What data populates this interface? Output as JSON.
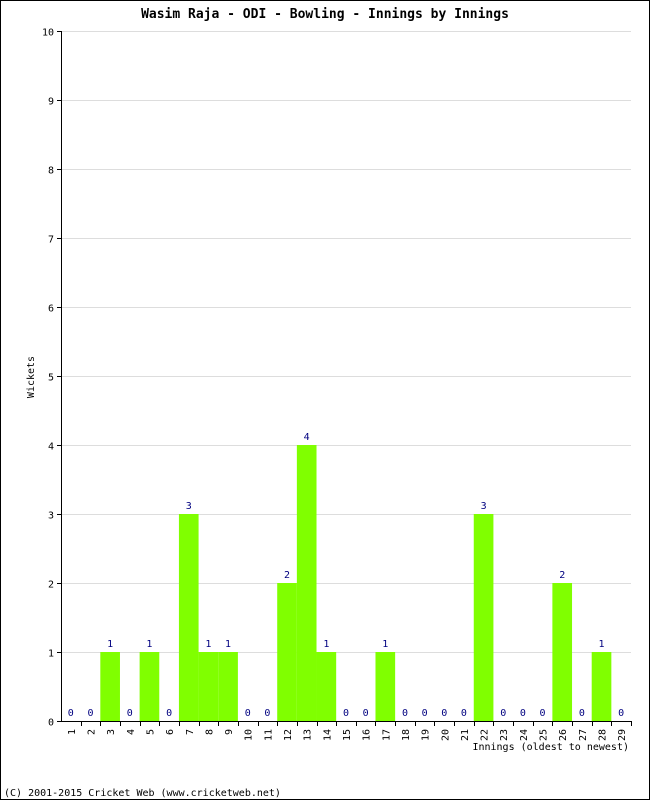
{
  "chart_data": {
    "type": "bar",
    "title": "Wasim Raja - ODI - Bowling - Innings by Innings",
    "xlabel": "Innings (oldest to newest)",
    "ylabel": "Wickets",
    "ylim": [
      0,
      10
    ],
    "yticks": [
      "0",
      "1",
      "2",
      "3",
      "4",
      "5",
      "6",
      "7",
      "8",
      "9",
      "10"
    ],
    "grid": true,
    "categories": [
      "1",
      "2",
      "3",
      "4",
      "5",
      "6",
      "7",
      "8",
      "9",
      "10",
      "11",
      "12",
      "13",
      "14",
      "15",
      "16",
      "17",
      "18",
      "19",
      "20",
      "21",
      "22",
      "23",
      "24",
      "25",
      "26",
      "27",
      "28",
      "29"
    ],
    "values": [
      0,
      0,
      1,
      0,
      1,
      0,
      3,
      1,
      1,
      0,
      0,
      2,
      4,
      1,
      0,
      0,
      1,
      0,
      0,
      0,
      0,
      3,
      0,
      0,
      0,
      2,
      0,
      1,
      0
    ],
    "bar_color": "#80ff00",
    "label_color": "#000080",
    "grid_color": "#dddddd"
  },
  "footer": "(C) 2001-2015 Cricket Web (www.cricketweb.net)"
}
